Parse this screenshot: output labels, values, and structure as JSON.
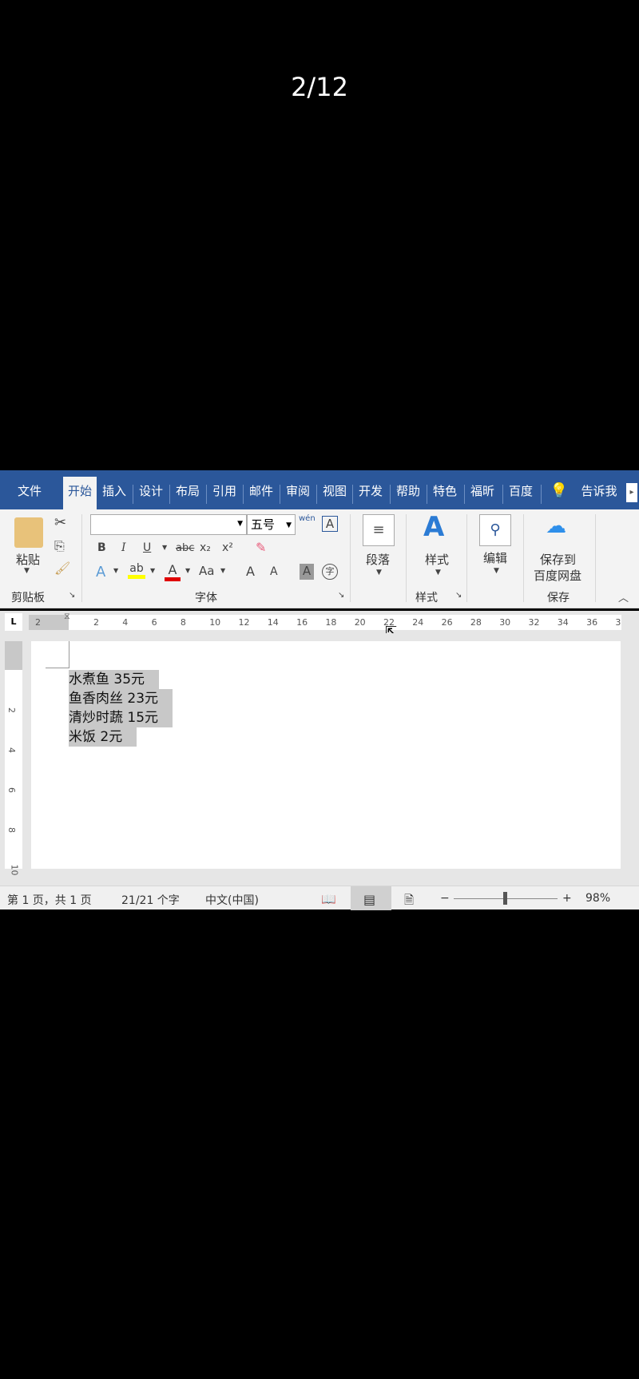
{
  "counter": "2/12",
  "tabs": [
    "文件",
    "开始",
    "插入",
    "设计",
    "布局",
    "引用",
    "邮件",
    "审阅",
    "视图",
    "开发",
    "帮助",
    "特色",
    "福昕",
    "百度",
    "告诉我"
  ],
  "ribbon": {
    "paste": "粘贴",
    "clipboard_group": "剪贴板",
    "font_name": "",
    "font_size": "五号",
    "phonetic": "wén",
    "bold": "B",
    "italic": "I",
    "underline": "U",
    "strike": "abc",
    "sub": "x₂",
    "sup": "x²",
    "grow": "A",
    "shrink": "A",
    "case": "Aa",
    "char_shade": "A",
    "enclose": "字",
    "font_group": "字体",
    "paragraph": "段落",
    "styles": "样式",
    "styles_group": "样式",
    "edit": "编辑",
    "save_baidu": "保存到",
    "save_baidu2": "百度网盘",
    "save_group": "保存"
  },
  "ruler": {
    "corner": "L",
    "numbers": [
      "2",
      "2",
      "4",
      "6",
      "8",
      "10",
      "12",
      "14",
      "16",
      "18",
      "20",
      "22",
      "24",
      "26",
      "28",
      "30",
      "32",
      "34",
      "36",
      "3"
    ],
    "vnumbers": [
      "2",
      "4",
      "6",
      "8",
      "10"
    ]
  },
  "document": {
    "lines": [
      "水煮鱼 35元",
      "鱼香肉丝 23元",
      "清炒时蔬 15元",
      "米饭 2元"
    ]
  },
  "status": {
    "page": "第 1 页，共 1 页",
    "words": "21/21 个字",
    "lang": "中文(中国)",
    "minus": "−",
    "plus": "+",
    "zoom": "98%",
    "zoom_fraction": 0.49
  },
  "colors": {
    "accent": "#2b579a",
    "highlight": "#ffff00",
    "font_color": "#e00000"
  }
}
